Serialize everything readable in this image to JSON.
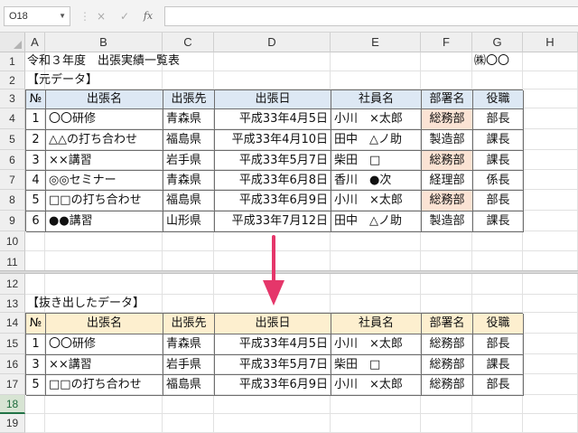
{
  "formula_bar": {
    "name_box": "O18",
    "cancel_glyph": "×",
    "enter_glyph": "✓",
    "fx_label": "fx",
    "formula": ""
  },
  "columns": [
    "A",
    "B",
    "C",
    "D",
    "E",
    "F",
    "G",
    "H"
  ],
  "rows": [
    "1",
    "2",
    "3",
    "4",
    "5",
    "6",
    "7",
    "8",
    "9",
    "10",
    "11",
    "12",
    "13",
    "14",
    "15",
    "16",
    "17",
    "18",
    "19"
  ],
  "selected_row": "18",
  "title": "令和３年度　出張実績一覧表",
  "company": "㈱〇〇",
  "source_label": "【元データ】",
  "extract_label": "【抜き出したデータ】",
  "headers": [
    "№",
    "出張名",
    "出張先",
    "出張日",
    "社員名",
    "部署名",
    "役職"
  ],
  "source_rows": [
    [
      "1",
      "〇〇研修",
      "青森県",
      "平成33年4月5日",
      "小川　×太郎",
      "総務部",
      "部長"
    ],
    [
      "2",
      "△△の打ち合わせ",
      "福島県",
      "平成33年4月10日",
      "田中　△ノ助",
      "製造部",
      "課長"
    ],
    [
      "3",
      "××講習",
      "岩手県",
      "平成33年5月7日",
      "柴田　□",
      "総務部",
      "課長"
    ],
    [
      "4",
      "◎◎セミナー",
      "青森県",
      "平成33年6月8日",
      "香川　●次",
      "経理部",
      "係長"
    ],
    [
      "5",
      "□□の打ち合わせ",
      "福島県",
      "平成33年6月9日",
      "小川　×太郎",
      "総務部",
      "部長"
    ],
    [
      "6",
      "●●講習",
      "山形県",
      "平成33年7月12日",
      "田中　△ノ助",
      "製造部",
      "課長"
    ]
  ],
  "highlighted_source_rows": [
    0,
    2,
    4
  ],
  "extract_rows": [
    [
      "1",
      "〇〇研修",
      "青森県",
      "平成33年4月5日",
      "小川　×太郎",
      "総務部",
      "部長"
    ],
    [
      "3",
      "××講習",
      "岩手県",
      "平成33年5月7日",
      "柴田　□",
      "総務部",
      "課長"
    ],
    [
      "5",
      "□□の打ち合わせ",
      "福島県",
      "平成33年6月9日",
      "小川　×太郎",
      "総務部",
      "部長"
    ]
  ],
  "colors": {
    "source_header_bg": "#dde8f4",
    "extract_header_bg": "#fdefcf",
    "highlight_bg": "#fbe3d4",
    "arrow": "#e5366a",
    "selected_row_accent": "#217346"
  },
  "icons": {
    "arrow": "down-arrow-icon"
  }
}
